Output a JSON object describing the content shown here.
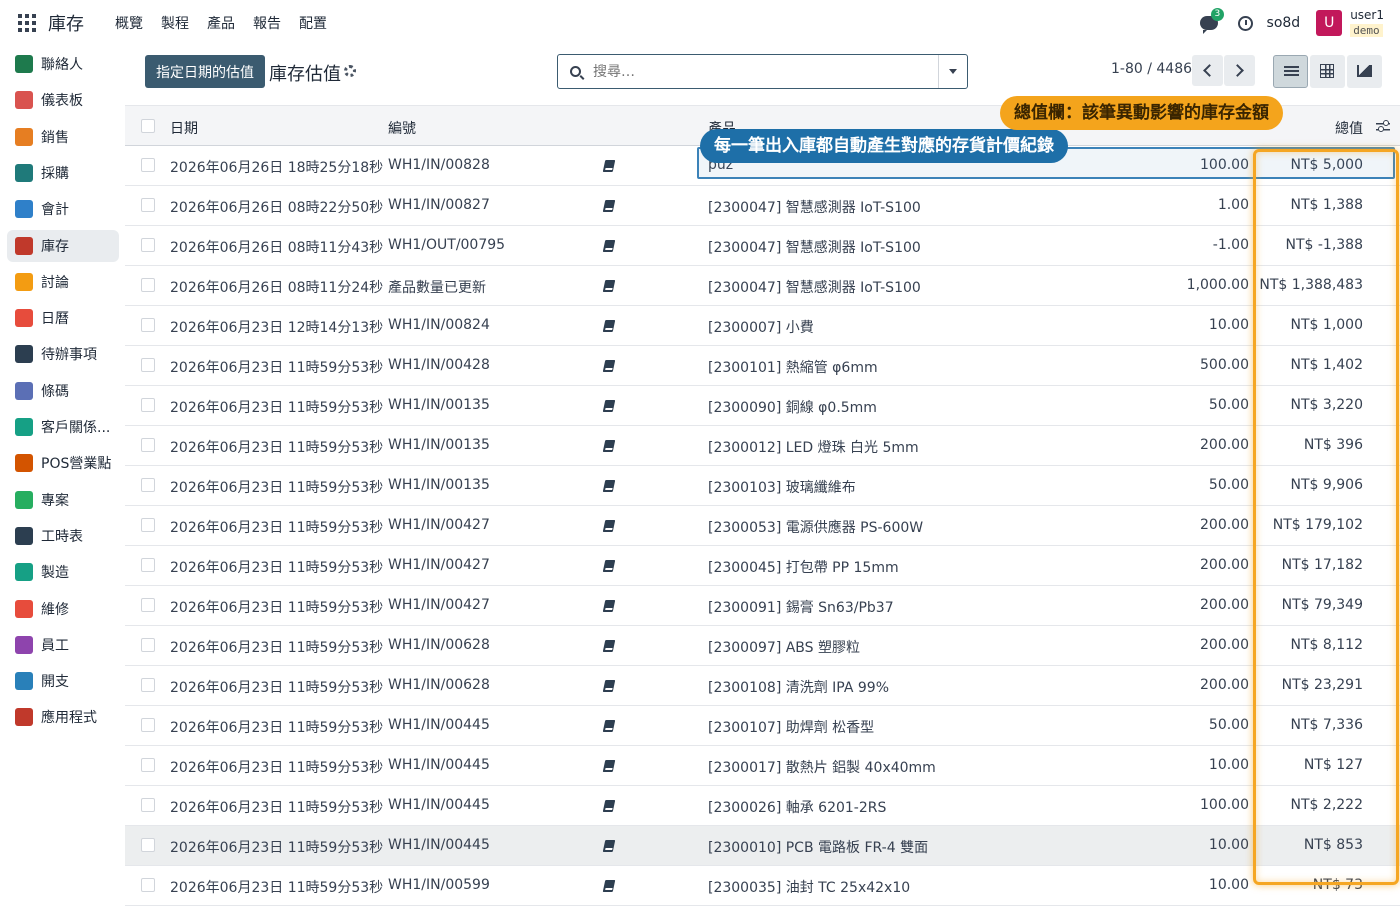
{
  "navbar": {
    "app_title": "庫存",
    "menu": [
      "概覽",
      "製程",
      "產品",
      "報告",
      "配置"
    ],
    "chat_badge": "3",
    "db_name": "so8d",
    "avatar_letter": "U",
    "user_name": "user1",
    "user_db": "demo"
  },
  "sidebar": {
    "items": [
      {
        "label": "聯絡人",
        "icon": "contacts-icon",
        "color": "#1e7a4d"
      },
      {
        "label": "儀表板",
        "icon": "dashboard-icon",
        "color": "#d9534f"
      },
      {
        "label": "銷售",
        "icon": "sales-icon",
        "color": "#e67e22"
      },
      {
        "label": "採購",
        "icon": "purchase-icon",
        "color": "#1f7a7a"
      },
      {
        "label": "會計",
        "icon": "accounting-icon",
        "color": "#2f80c9"
      },
      {
        "label": "庫存",
        "icon": "inventory-icon",
        "color": "#c0392b"
      },
      {
        "label": "討論",
        "icon": "discuss-icon",
        "color": "#f39c12"
      },
      {
        "label": "日曆",
        "icon": "calendar-icon",
        "color": "#e74c3c"
      },
      {
        "label": "待辦事項",
        "icon": "todo-icon",
        "color": "#2c3e50"
      },
      {
        "label": "條碼",
        "icon": "barcode-icon",
        "color": "#5b6fb5"
      },
      {
        "label": "客戶關係...",
        "icon": "crm-icon",
        "color": "#16a085"
      },
      {
        "label": "POS營業點",
        "icon": "pos-icon",
        "color": "#d35400"
      },
      {
        "label": "專案",
        "icon": "project-icon",
        "color": "#27ae60"
      },
      {
        "label": "工時表",
        "icon": "timesheet-icon",
        "color": "#2c3e50"
      },
      {
        "label": "製造",
        "icon": "manufacturing-icon",
        "color": "#16a085"
      },
      {
        "label": "維修",
        "icon": "repair-icon",
        "color": "#e74c3c"
      },
      {
        "label": "員工",
        "icon": "employees-icon",
        "color": "#8e44ad"
      },
      {
        "label": "開支",
        "icon": "expenses-icon",
        "color": "#2980b9"
      },
      {
        "label": "應用程式",
        "icon": "apps-icon",
        "color": "#c0392b"
      }
    ],
    "active_index": 5
  },
  "control": {
    "primary_button": "指定日期的估值",
    "title": "庫存估值",
    "search_placeholder": "搜尋…",
    "pager": "1-80 / 4486"
  },
  "table": {
    "headers": {
      "date": "日期",
      "ref": "編號",
      "product": "產品",
      "total": "總值"
    },
    "rows": [
      {
        "date": "2026年06月26日 18時25分18秒",
        "ref": "WH1/IN/00828",
        "product": "puz",
        "qty": "100.00",
        "value": "NT$ 5,000"
      },
      {
        "date": "2026年06月26日 08時22分50秒",
        "ref": "WH1/IN/00827",
        "product": "[2300047] 智慧感測器 IoT-S100",
        "qty": "1.00",
        "value": "NT$ 1,388"
      },
      {
        "date": "2026年06月26日 08時11分43秒",
        "ref": "WH1/OUT/00795",
        "product": "[2300047] 智慧感測器 IoT-S100",
        "qty": "-1.00",
        "value": "NT$ -1,388"
      },
      {
        "date": "2026年06月26日 08時11分24秒",
        "ref": "產品數量已更新",
        "product": "[2300047] 智慧感測器 IoT-S100",
        "qty": "1,000.00",
        "value": "NT$ 1,388,483"
      },
      {
        "date": "2026年06月23日 12時14分13秒",
        "ref": "WH1/IN/00824",
        "product": "[2300007] 小費",
        "qty": "10.00",
        "value": "NT$ 1,000"
      },
      {
        "date": "2026年06月23日 11時59分53秒",
        "ref": "WH1/IN/00428",
        "product": "[2300101] 熱縮管 φ6mm",
        "qty": "500.00",
        "value": "NT$ 1,402"
      },
      {
        "date": "2026年06月23日 11時59分53秒",
        "ref": "WH1/IN/00135",
        "product": "[2300090] 銅線 φ0.5mm",
        "qty": "50.00",
        "value": "NT$ 3,220"
      },
      {
        "date": "2026年06月23日 11時59分53秒",
        "ref": "WH1/IN/00135",
        "product": "[2300012] LED 燈珠 白光 5mm",
        "qty": "200.00",
        "value": "NT$ 396"
      },
      {
        "date": "2026年06月23日 11時59分53秒",
        "ref": "WH1/IN/00135",
        "product": "[2300103] 玻璃纖維布",
        "qty": "50.00",
        "value": "NT$ 9,906"
      },
      {
        "date": "2026年06月23日 11時59分53秒",
        "ref": "WH1/IN/00427",
        "product": "[2300053] 電源供應器 PS-600W",
        "qty": "200.00",
        "value": "NT$ 179,102"
      },
      {
        "date": "2026年06月23日 11時59分53秒",
        "ref": "WH1/IN/00427",
        "product": "[2300045] 打包帶 PP 15mm",
        "qty": "200.00",
        "value": "NT$ 17,182"
      },
      {
        "date": "2026年06月23日 11時59分53秒",
        "ref": "WH1/IN/00427",
        "product": "[2300091] 錫膏 Sn63/Pb37",
        "qty": "200.00",
        "value": "NT$ 79,349"
      },
      {
        "date": "2026年06月23日 11時59分53秒",
        "ref": "WH1/IN/00628",
        "product": "[2300097] ABS 塑膠粒",
        "qty": "200.00",
        "value": "NT$ 8,112"
      },
      {
        "date": "2026年06月23日 11時59分53秒",
        "ref": "WH1/IN/00628",
        "product": "[2300108] 清洗劑 IPA 99%",
        "qty": "200.00",
        "value": "NT$ 23,291"
      },
      {
        "date": "2026年06月23日 11時59分53秒",
        "ref": "WH1/IN/00445",
        "product": "[2300107] 助焊劑 松香型",
        "qty": "50.00",
        "value": "NT$ 7,336"
      },
      {
        "date": "2026年06月23日 11時59分53秒",
        "ref": "WH1/IN/00445",
        "product": "[2300017] 散熱片 鋁製 40x40mm",
        "qty": "10.00",
        "value": "NT$ 127"
      },
      {
        "date": "2026年06月23日 11時59分53秒",
        "ref": "WH1/IN/00445",
        "product": "[2300026] 軸承 6201-2RS",
        "qty": "100.00",
        "value": "NT$ 2,222"
      },
      {
        "date": "2026年06月23日 11時59分53秒",
        "ref": "WH1/IN/00445",
        "product": "[2300010] PCB 電路板 FR-4 雙面",
        "qty": "10.00",
        "value": "NT$ 853"
      },
      {
        "date": "2026年06月23日 11時59分53秒",
        "ref": "WH1/IN/00599",
        "product": "[2300035] 油封 TC 25x42x10",
        "qty": "10.00",
        "value": "NT$ 73"
      }
    ],
    "hover_row_index": 17
  },
  "annotations": {
    "row_callout": "每一筆出入庫都自動產生對應的存貨計價紀錄",
    "column_callout": "總值欄：該筆異動影響的庫存金額",
    "row_color": "#1e6fa8",
    "column_color": "#f4a41c"
  }
}
